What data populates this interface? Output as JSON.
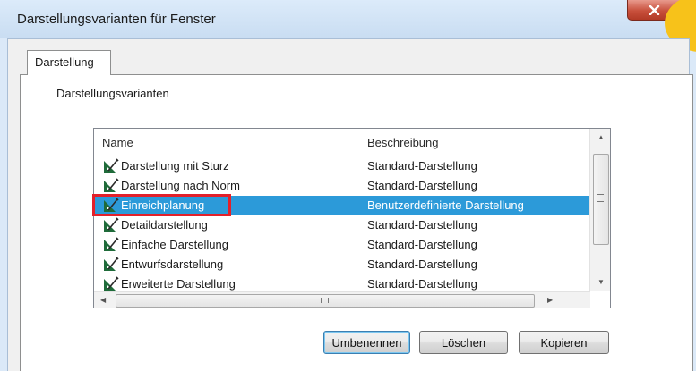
{
  "window": {
    "title": "Darstellungsvarianten für Fenster"
  },
  "tabs": [
    {
      "label": "Darstellung"
    }
  ],
  "group": {
    "label": "Darstellungsvarianten"
  },
  "list": {
    "columns": [
      "Name",
      "Beschreibung"
    ],
    "rows": [
      {
        "name": "Darstellung mit Sturz",
        "description": "Standard-Darstellung"
      },
      {
        "name": "Darstellung nach Norm",
        "description": "Standard-Darstellung"
      },
      {
        "name": "Einreichplanung",
        "description": "Benutzerdefinierte Darstellung",
        "selected": true
      },
      {
        "name": "Detaildarstellung",
        "description": "Standard-Darstellung"
      },
      {
        "name": "Einfache Darstellung",
        "description": "Standard-Darstellung"
      },
      {
        "name": "Entwurfsdarstellung",
        "description": "Standard-Darstellung"
      },
      {
        "name": "Erweiterte Darstellung",
        "description": "Standard-Darstellung"
      }
    ],
    "row_icon": "drafting-ruler-icon",
    "hscroll_grip": "III"
  },
  "buttons": {
    "rename": "Umbenennen",
    "delete": "Löschen",
    "copy": "Kopieren"
  },
  "colors": {
    "selection": "#2c9ad9",
    "highlight": "#e3202a",
    "close": "#c8503c"
  }
}
